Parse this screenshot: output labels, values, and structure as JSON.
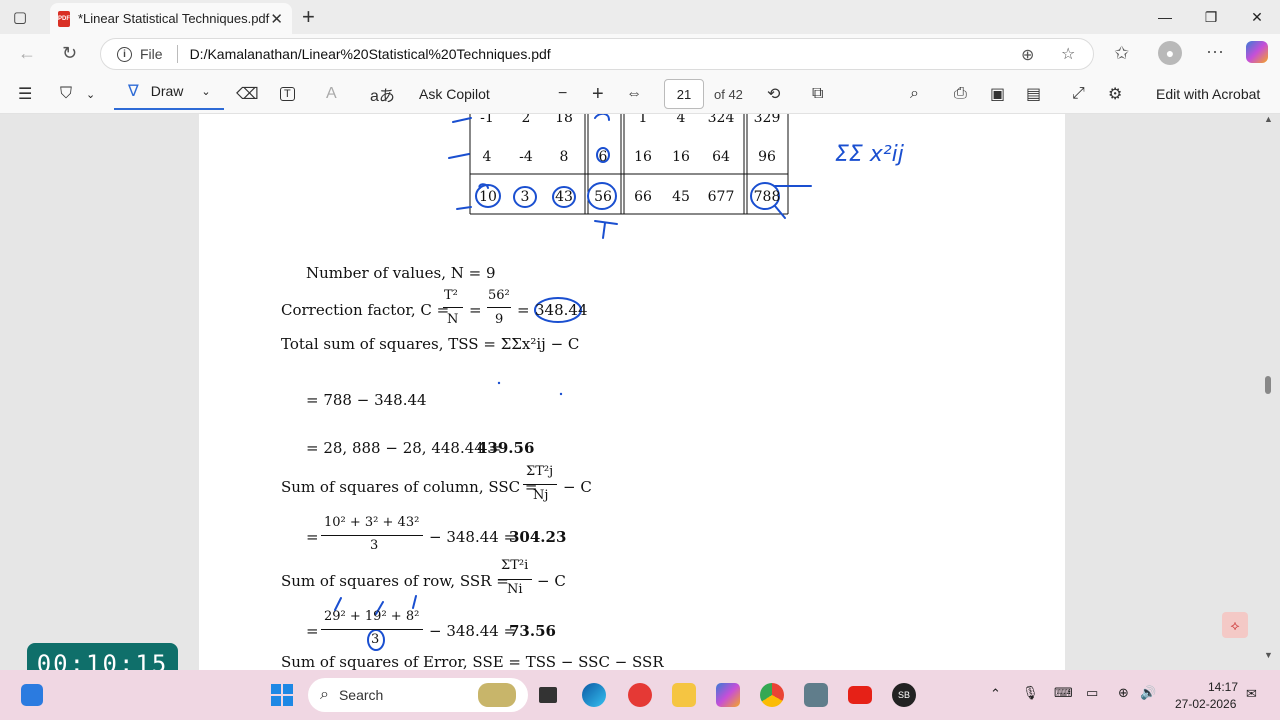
{
  "browser": {
    "tab_title": "*Linear Statistical Techniques.pdf",
    "pdf_badge": "PDF",
    "file_label": "File",
    "url": "D:/Kamalanathan/Linear%20Statistical%20Techniques.pdf"
  },
  "pdf_toolbar": {
    "draw_label": "Draw",
    "ask_copilot": "Ask Copilot",
    "page_current": "21",
    "page_total": "of 42",
    "edit_acrobat": "Edit with Acrobat"
  },
  "table": {
    "row_partial": [
      "-1",
      "2",
      "18",
      "1",
      "4",
      "324",
      "329"
    ],
    "row2": [
      "4",
      "-4",
      "8",
      "6",
      "16",
      "16",
      "64",
      "96"
    ],
    "totals": [
      "10",
      "3",
      "43",
      "56",
      "66",
      "45",
      "677",
      "788"
    ]
  },
  "annotation_text": "ΣΣ x²ij",
  "math": {
    "line1": "Number of values, N = 9",
    "line2_prefix": "Correction factor, C =",
    "line2_frac1_num": "T²",
    "line2_frac1_den": "N",
    "line2_frac2_num": "56²",
    "line2_frac2_den": "9",
    "line2_result": "348.44",
    "line3": "Total sum of squares, TSS = ΣΣx²ij − C",
    "line4": "= 788 − 348.44",
    "line5_prefix": "= 28, 888 − 28, 448.44 =",
    "line5_result": "439.56",
    "line6_prefix": "Sum of squares of column, SSC =",
    "line6_num": "ΣT²j",
    "line6_den": "Nj",
    "line6_suffix": "− C",
    "line7_num": "10² + 3² + 43²",
    "line7_den": "3",
    "line7_suffix": "− 348.44 =",
    "line7_result": "304.23",
    "line8_prefix": "Sum of squares of row, SSR =",
    "line8_num": "ΣT²i",
    "line8_den": "Ni",
    "line8_suffix": "− C",
    "line9_num": "29² + 19² + 8²",
    "line9_den": "3",
    "line9_suffix": "− 348.44 =",
    "line9_result": "73.56",
    "line10": "Sum of squares of Error, SSE = TSS − SSC − SSR"
  },
  "timer": "00:10:15",
  "taskbar": {
    "search": "Search",
    "time": "14:17",
    "date": "27-02-2026"
  }
}
